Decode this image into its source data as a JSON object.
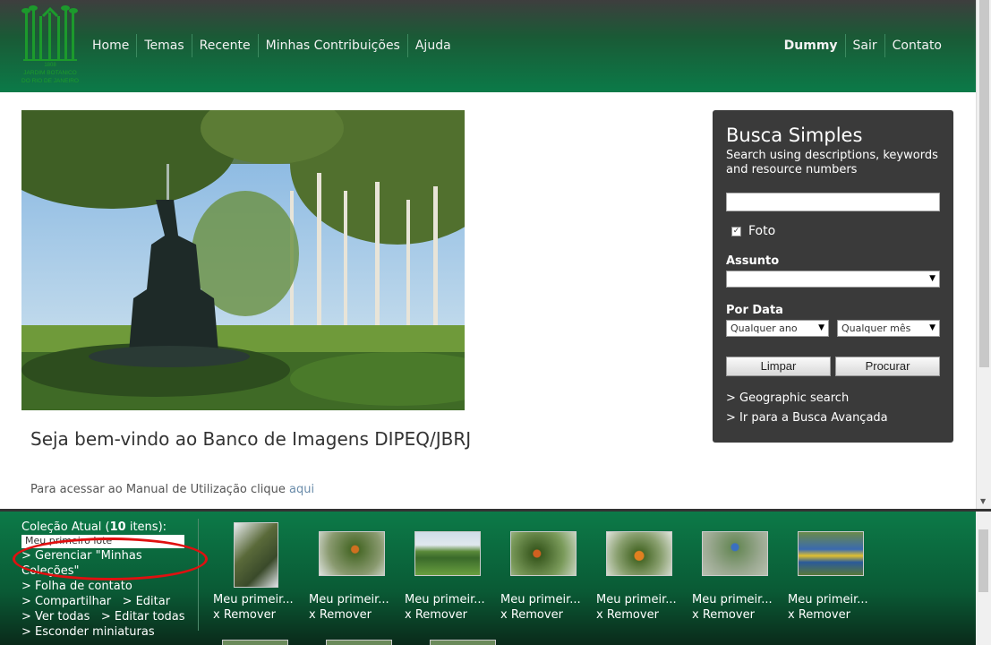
{
  "logo": {
    "text1": "JARDIM BOTANICO",
    "text2": "DO RIO DE JANEIRO",
    "year": "1808"
  },
  "nav": {
    "items": [
      "Home",
      "Temas",
      "Recente",
      "Minhas Contribuições",
      "Ajuda"
    ]
  },
  "nav_right": {
    "user": "Dummy",
    "logout": "Sair",
    "contact": "Contato"
  },
  "main": {
    "welcome": "Seja bem-vindo ao Banco de Imagens DIPEQ/JBRJ",
    "manual_text": "Para acessar ao Manual de Utilização clique ",
    "manual_link": "aqui"
  },
  "search": {
    "title": "Busca Simples",
    "description": "Search using descriptions, keywords and resource numbers",
    "input_value": "",
    "foto_label": "Foto",
    "foto_checked": true,
    "subject_label": "Assunto",
    "subject_value": "",
    "date_label": "Por Data",
    "year_value": "Qualquer ano",
    "month_value": "Qualquer mês",
    "clear_label": "Limpar",
    "search_label": "Procurar",
    "geo_link": "> Geographic search",
    "advanced_link": "> Ir para a Busca Avançada"
  },
  "collection": {
    "title_prefix": "Coleção Atual (",
    "count": "10",
    "title_suffix": " itens):",
    "selected": "Meu primeiro lote",
    "manage_link": "> Gerenciar \"Minhas Coleções\"",
    "contact_sheet": "> Folha de contato",
    "share": "> Compartilhar",
    "edit": "> Editar",
    "view_all": "> Ver todas",
    "edit_all": "> Editar todas",
    "hide_thumbs": "> Esconder miniaturas",
    "items": [
      {
        "caption": "Meu primeir...",
        "remove": "x Remover"
      },
      {
        "caption": "Meu primeir...",
        "remove": "x Remover"
      },
      {
        "caption": "Meu primeir...",
        "remove": "x Remover"
      },
      {
        "caption": "Meu primeir...",
        "remove": "x Remover"
      },
      {
        "caption": "Meu primeir...",
        "remove": "x Remover"
      },
      {
        "caption": "Meu primeir...",
        "remove": "x Remover"
      },
      {
        "caption": "Meu primeir...",
        "remove": "x Remover"
      }
    ]
  },
  "colors": {
    "header_green": "#0b7a48",
    "panel_dark": "#3a3a3a",
    "highlight_red": "#e01010"
  }
}
